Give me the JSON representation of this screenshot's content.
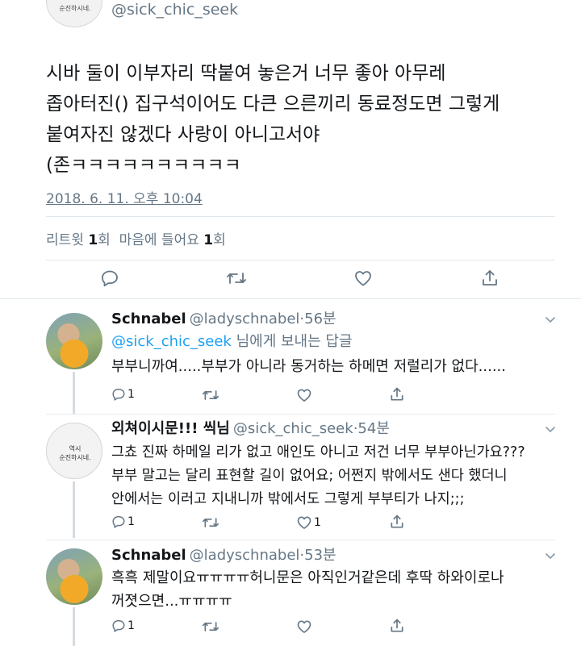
{
  "main": {
    "avatar_text": "순진하시네.",
    "handle": "@sick_chic_seek",
    "text": "시바 둘이 이부자리 딱붙여 놓은거 너무 좋아 아무레\n좁아터진() 집구석이어도 다큰 으른끼리 동료정도면 그렇게\n붙여자진 않겠다 사랑이 아니고서야\n(존ㅋㅋㅋㅋㅋㅋㅋㅋㅋㅋ",
    "date": "2018. 6. 11. 오후 10:04",
    "stats": {
      "retweet_label": "리트윗",
      "retweet_count": "1",
      "retweet_unit": "회",
      "like_label": "마음에 들어요",
      "like_count": "1",
      "like_unit": "회"
    }
  },
  "icons": [
    "reply-icon",
    "retweet-icon",
    "like-icon",
    "share-icon",
    "chevron-down-icon"
  ],
  "replies": [
    {
      "name": "Schnabel",
      "handle": "@ladyschnabel",
      "time": "56분",
      "reply_to_link": "@sick_chic_seek",
      "reply_to_suffix": " 님에게 보내는 답글",
      "text": "부부니까여.....부부가 아니라 동거하는 하메면 저럴리가 없다......",
      "reply_count": "1",
      "like_count": ""
    },
    {
      "name": "외쳐이시문!!! 씩님",
      "handle": "@sick_chic_seek",
      "time": "54분",
      "avatar_text": "역시\n순진하시네.",
      "text": "그쵸 진짜 하메일 리가 없고 애인도 아니고 저건 너무 부부아닌가요???\n부부 말고는 달리 표현할 길이 없어요; 어쩐지 밖에서도 샌다 했더니\n안에서는 이러고 지내니까 밖에서도 그렇게 부부티가 나지;;;",
      "reply_count": "1",
      "like_count": "1"
    },
    {
      "name": "Schnabel",
      "handle": "@ladyschnabel",
      "time": "53분",
      "text": "흑흑 제말이요ㅠㅠㅠㅠ허니문은 아직인거같은데 후딱 하와이로나\n꺼졋으면...ㅠㅠㅠㅠ",
      "reply_count": "1",
      "like_count": ""
    }
  ]
}
